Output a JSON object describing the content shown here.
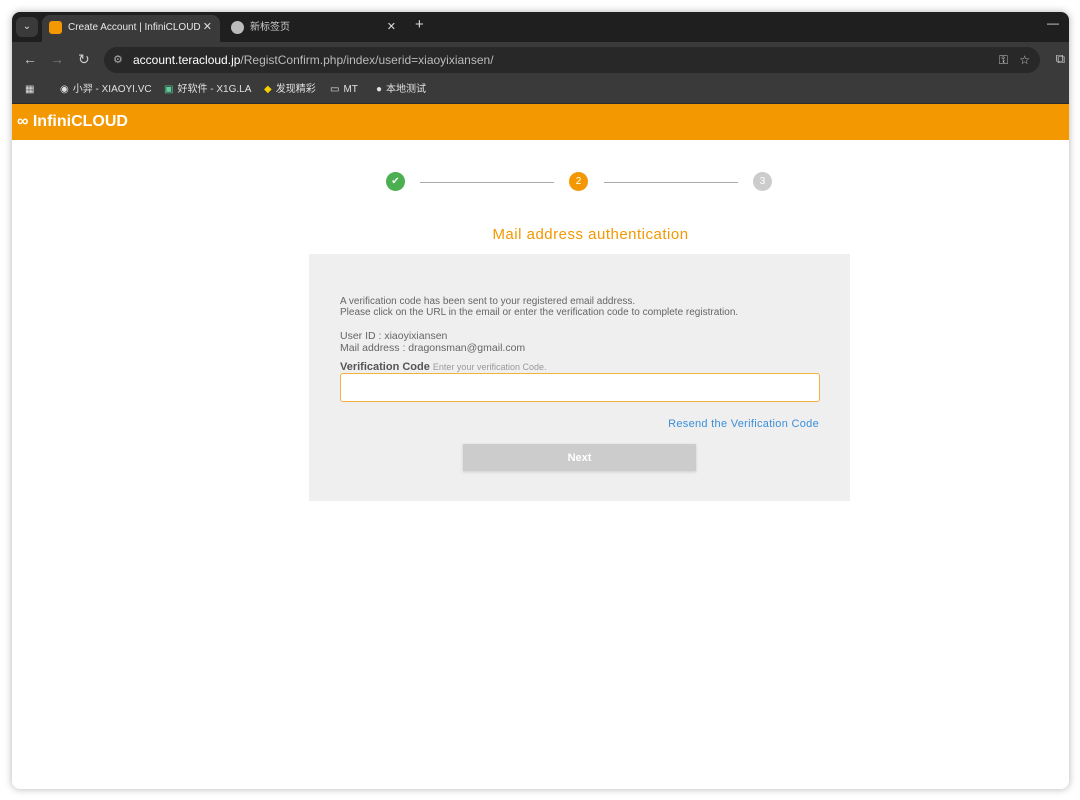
{
  "browser": {
    "tabs": [
      {
        "label": "Create Account | InfiniCLOUD",
        "active": true
      },
      {
        "label": "新标签页",
        "active": false
      }
    ],
    "url_domain": "account.teracloud.jp",
    "url_path": "/RegistConfirm.php/index/userid=xiaoyixiansen/",
    "bookmarks": [
      {
        "label": "小羿 - XIAOYI.VC"
      },
      {
        "label": "好软件 - X1G.LA"
      },
      {
        "label": "发现精彩"
      },
      {
        "label": "MT",
        "icon": "folder-icon"
      },
      {
        "label": "本地测试",
        "icon": "globe-icon"
      }
    ]
  },
  "header": {
    "logo": "InfiniCLOUD",
    "brand_color": "#f39800"
  },
  "steps": [
    {
      "label": "✔",
      "state": "done",
      "color": "#4caf50"
    },
    {
      "label": "2",
      "state": "current",
      "color": "#f39800"
    },
    {
      "label": "3",
      "state": "pending",
      "color": "#cccccc"
    }
  ],
  "page": {
    "title": "Mail address authentication",
    "message1": "A verification code has been sent to your registered email address.",
    "message2": "Please click on the URL in the email or enter the verification code to complete registration.",
    "user_id": "User ID : xiaoyixiansen",
    "mail": "Mail address : dragonsman@gmail.com",
    "code_label": "Verification Code",
    "code_hint": "Enter your verification Code.",
    "code_value": "",
    "resend": "Resend the Verification Code",
    "next": "Next"
  }
}
